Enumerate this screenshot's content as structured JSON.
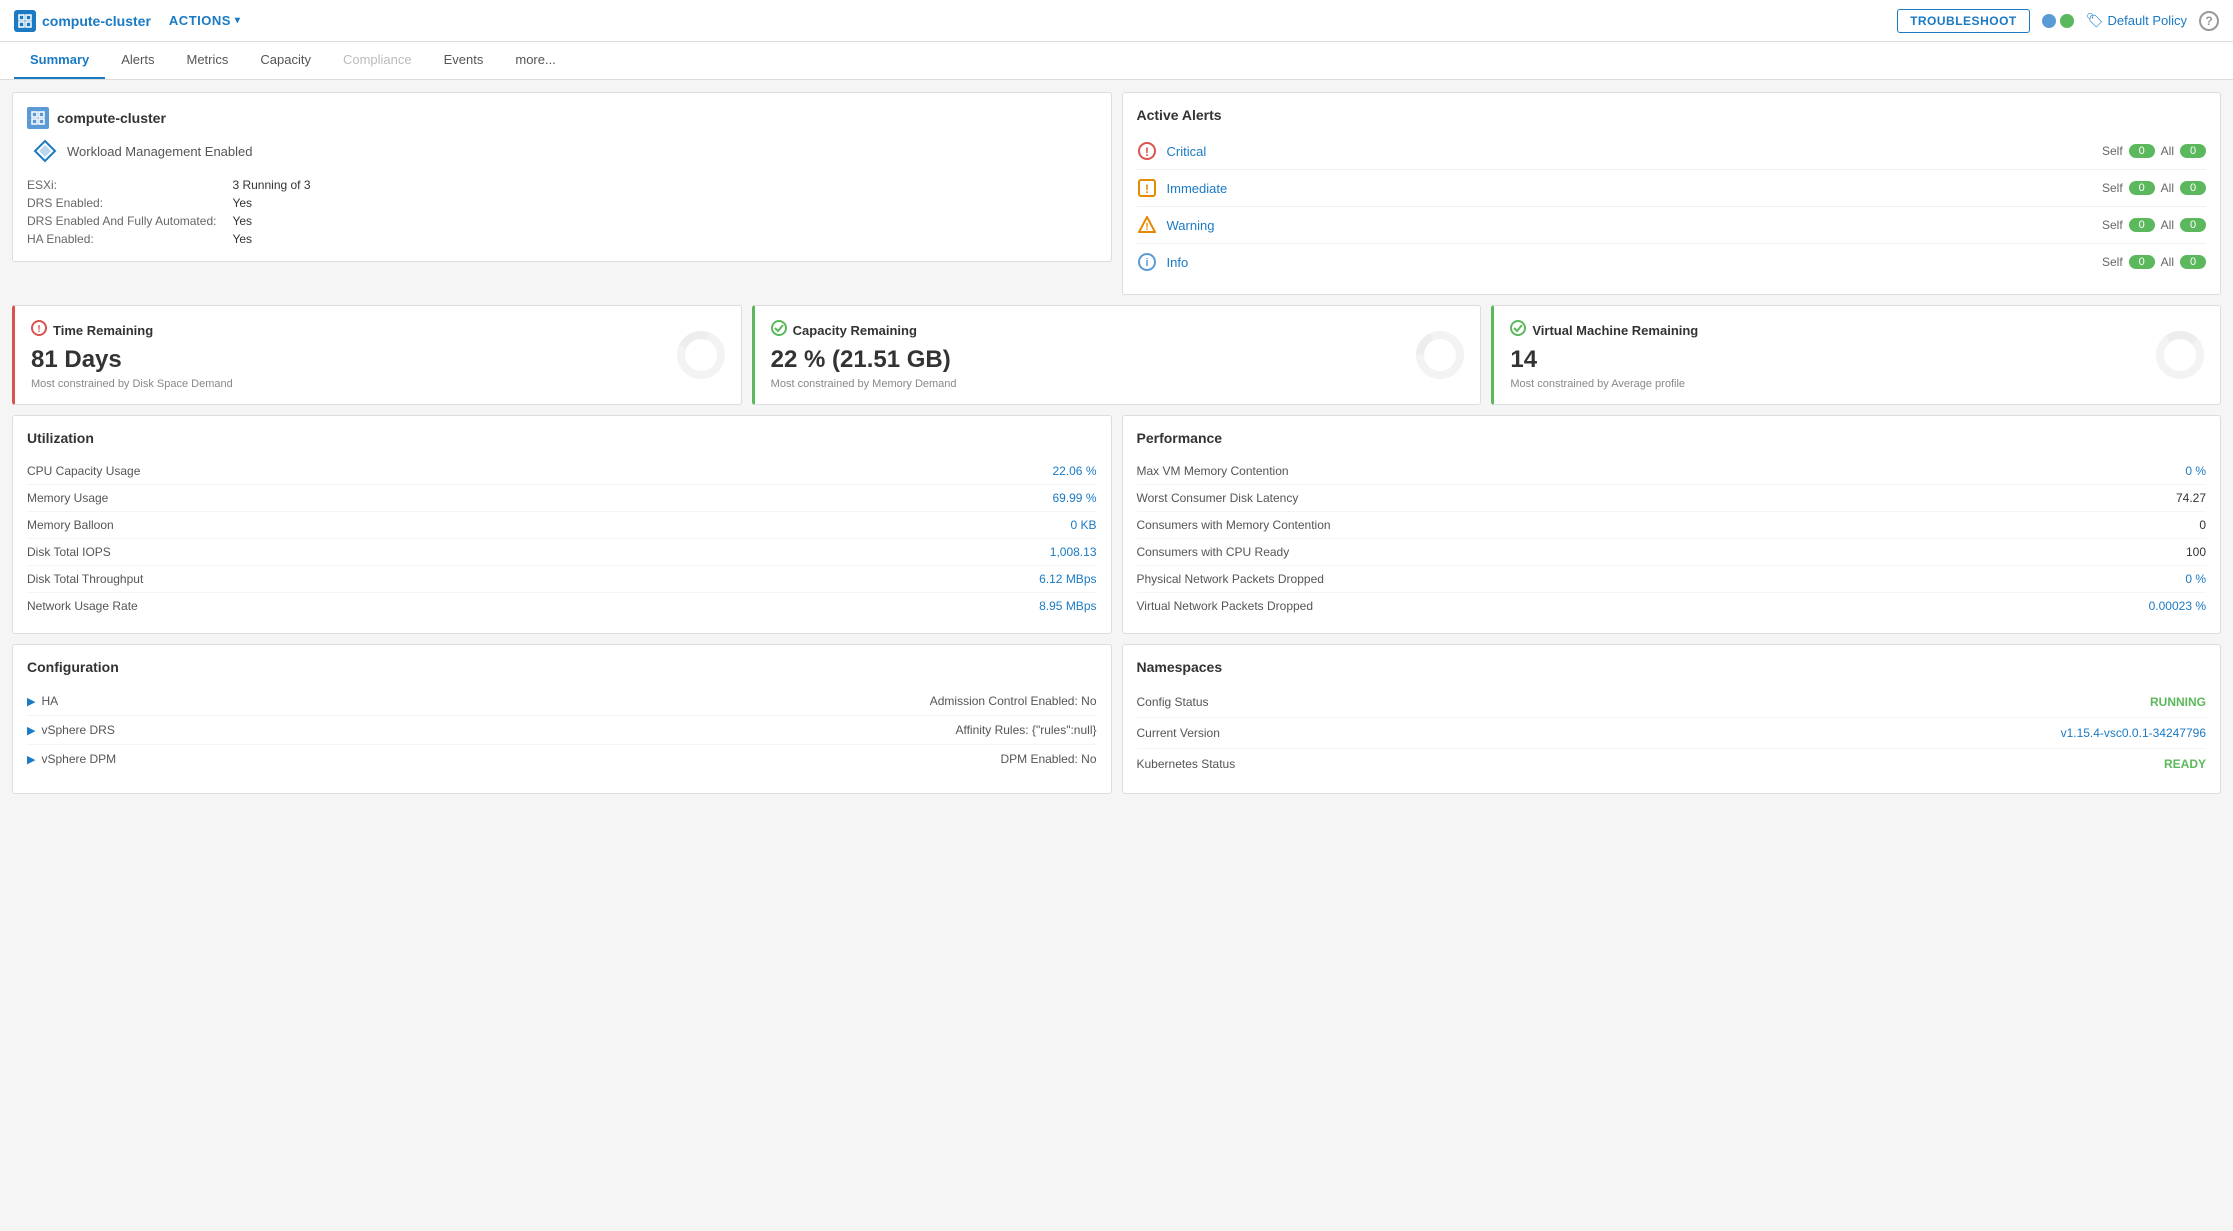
{
  "topbar": {
    "logo_text": "compute-cluster",
    "actions_label": "ACTIONS",
    "troubleshoot_label": "TROUBLESHOOT",
    "policy_label": "Default Policy",
    "help_label": "?"
  },
  "nav": {
    "tabs": [
      {
        "id": "summary",
        "label": "Summary",
        "active": true
      },
      {
        "id": "alerts",
        "label": "Alerts"
      },
      {
        "id": "metrics",
        "label": "Metrics"
      },
      {
        "id": "capacity",
        "label": "Capacity"
      },
      {
        "id": "compliance",
        "label": "Compliance",
        "disabled": true
      },
      {
        "id": "events",
        "label": "Events"
      },
      {
        "id": "more",
        "label": "more..."
      }
    ]
  },
  "cluster_info": {
    "title": "compute-cluster",
    "workload_label": "Workload Management Enabled",
    "fields": [
      {
        "label": "ESXi:",
        "value": "3 Running of 3"
      },
      {
        "label": "DRS Enabled:",
        "value": "Yes"
      },
      {
        "label": "DRS Enabled And Fully Automated:",
        "value": "Yes"
      },
      {
        "label": "HA Enabled:",
        "value": "Yes"
      }
    ]
  },
  "active_alerts": {
    "title": "Active Alerts",
    "alerts": [
      {
        "id": "critical",
        "icon": "⊙",
        "icon_color": "#d9534f",
        "name": "Critical",
        "self_count": "0",
        "all_count": "0"
      },
      {
        "id": "immediate",
        "icon": "!",
        "icon_color": "#e68a00",
        "name": "Immediate",
        "self_count": "0",
        "all_count": "0"
      },
      {
        "id": "warning",
        "icon": "⚠",
        "icon_color": "#e68a00",
        "name": "Warning",
        "self_count": "0",
        "all_count": "0"
      },
      {
        "id": "info",
        "icon": "ℹ",
        "icon_color": "#5b9bd5",
        "name": "Info",
        "self_count": "0",
        "all_count": "0"
      }
    ]
  },
  "metric_cards": [
    {
      "id": "time-remaining",
      "border_color": "red",
      "icon": "⊙",
      "icon_type": "red",
      "title": "Time Remaining",
      "value": "81 Days",
      "subtitle": "Most constrained by Disk Space Demand"
    },
    {
      "id": "capacity-remaining",
      "border_color": "green",
      "icon": "✓",
      "icon_type": "green",
      "title": "Capacity Remaining",
      "value": "22 % (21.51 GB)",
      "subtitle": "Most constrained by Memory Demand"
    },
    {
      "id": "vm-remaining",
      "border_color": "green",
      "icon": "✓",
      "icon_type": "green",
      "title": "Virtual Machine Remaining",
      "value": "14",
      "subtitle": "Most constrained by Average profile"
    }
  ],
  "utilization": {
    "title": "Utilization",
    "rows": [
      {
        "label": "CPU Capacity Usage",
        "value": "22.06 %",
        "colored": true
      },
      {
        "label": "Memory Usage",
        "value": "69.99 %",
        "colored": true
      },
      {
        "label": "Memory Balloon",
        "value": "0 KB",
        "colored": true
      },
      {
        "label": "Disk Total IOPS",
        "value": "1,008.13",
        "colored": true
      },
      {
        "label": "Disk Total Throughput",
        "value": "6.12 MBps",
        "colored": true
      },
      {
        "label": "Network Usage Rate",
        "value": "8.95 MBps",
        "colored": true
      }
    ]
  },
  "performance": {
    "title": "Performance",
    "rows": [
      {
        "label": "Max VM Memory Contention",
        "value": "0 %",
        "colored": true
      },
      {
        "label": "Worst Consumer Disk Latency",
        "value": "74.27",
        "colored": false
      },
      {
        "label": "Consumers with Memory Contention",
        "value": "0",
        "colored": false
      },
      {
        "label": "Consumers with CPU Ready",
        "value": "100",
        "colored": false
      },
      {
        "label": "Physical Network Packets Dropped",
        "value": "0 %",
        "colored": true
      },
      {
        "label": "Virtual Network Packets Dropped",
        "value": "0.00023 %",
        "colored": true
      }
    ]
  },
  "configuration": {
    "title": "Configuration",
    "items": [
      {
        "label": "HA",
        "right": "Admission Control Enabled: No"
      },
      {
        "label": "vSphere DRS",
        "right": "Affinity Rules: {\"rules\":null}"
      },
      {
        "label": "vSphere DPM",
        "right": "DPM Enabled: No"
      }
    ]
  },
  "namespaces": {
    "title": "Namespaces",
    "rows": [
      {
        "label": "Config Status",
        "value": "RUNNING",
        "value_class": "green"
      },
      {
        "label": "Current Version",
        "value": "v1.15.4-vsc0.0.1-34247796",
        "value_class": "blue"
      },
      {
        "label": "Kubernetes Status",
        "value": "READY",
        "value_class": "green"
      }
    ]
  }
}
